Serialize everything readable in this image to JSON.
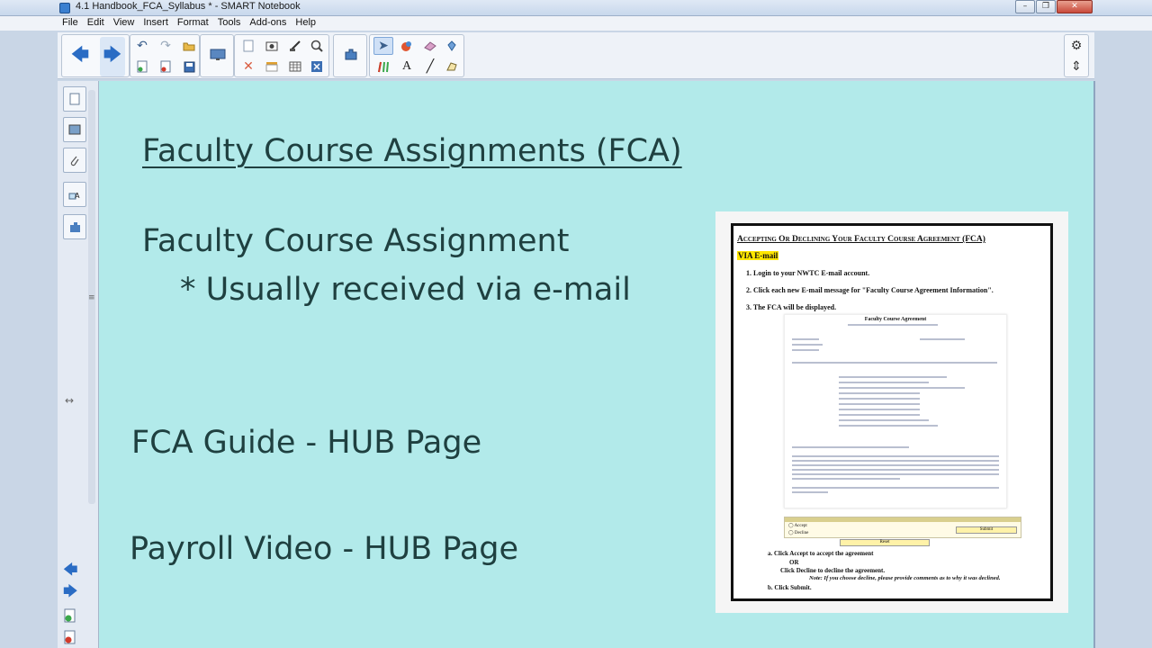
{
  "window": {
    "title": "4.1 Handbook_FCA_Syllabus * - SMART Notebook",
    "buttons": {
      "minimize": "–",
      "maximize": "❐",
      "close": "✕"
    }
  },
  "menu": [
    "File",
    "Edit",
    "View",
    "Insert",
    "Format",
    "Tools",
    "Add-ons",
    "Help"
  ],
  "toolbar": {
    "icons": [
      "back-arrow-icon",
      "forward-arrow-icon",
      "undo-icon",
      "redo-icon",
      "open-folder-icon",
      "new-page-icon",
      "delete-page-icon",
      "save-icon",
      "screen-display-icon",
      "add-page-icon",
      "capture-icon",
      "screen-shade-icon",
      "table-icon",
      "delete-icon",
      "add-ons-icon",
      "select-icon",
      "pen-icon",
      "eraser-icon",
      "fill-icon",
      "creative-pen-icon",
      "text-icon",
      "line-icon",
      "shape-icon",
      "settings-icon",
      "move-toolbar-icon"
    ],
    "glyphs": {
      "back": "🡄",
      "forward": "🡆",
      "undo": "↶",
      "redo": "↷",
      "open": "📂",
      "select": "➤",
      "text": "A",
      "line": "╱",
      "settings": "⚙",
      "move": "⇕"
    }
  },
  "slide": {
    "heading": "Faculty Course Assignments (FCA)",
    "line1": "Faculty Course Assignment",
    "line2": "* Usually received via e-mail",
    "line3": "FCA Guide - HUB Page",
    "line4": "Payroll Video - HUB Page"
  },
  "doc": {
    "title": "Accepting Or Declining Your Faculty Course Agreement (FCA)",
    "via": "VIA E-mail",
    "step1": "1.   Login to your NWTC E-mail account.",
    "step2": "2.   Click each new E-mail message for \"Faculty Course Agreement Information\".",
    "step3": "3.   The FCA will be displayed.",
    "inner_title": "Faculty Course Agreement",
    "accept": "◯ Accept",
    "decline": "◯ Decline",
    "submit": "Submit",
    "reset": "Reset",
    "a": "a.    Click Accept to accept the agreement",
    "or": "OR",
    "a2": "Click Decline to decline the agreement.",
    "note": "Note: If you choose decline, please provide comments as to why it was declined.",
    "b": "b.    Click Submit."
  }
}
